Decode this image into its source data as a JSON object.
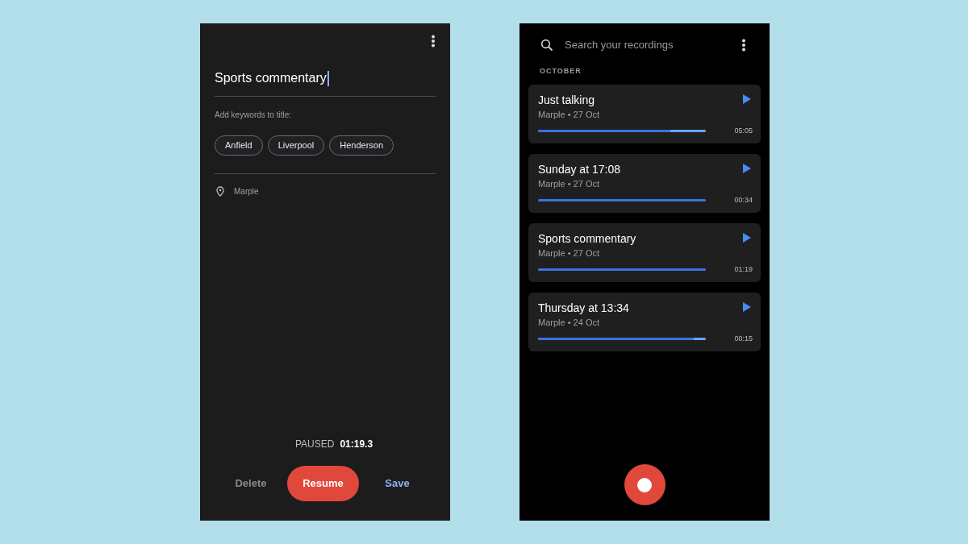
{
  "editor": {
    "title": "Sports commentary",
    "keywords_label": "Add keywords to title:",
    "keywords": [
      "Anfield",
      "Liverpool",
      "Henderson"
    ],
    "location": "Marple",
    "status": "PAUSED",
    "time": "01:19.3",
    "buttons": {
      "delete": "Delete",
      "resume": "Resume",
      "save": "Save"
    }
  },
  "library": {
    "search": {
      "placeholder": "Search your recordings"
    },
    "section": "OCTOBER",
    "recordings": [
      {
        "title": "Just talking",
        "meta": "Marple • 27 Oct",
        "duration": "05:05",
        "level": 0.79
      },
      {
        "title": "Sunday at 17:08",
        "meta": "Marple • 27 Oct",
        "duration": "00:34",
        "level": 1
      },
      {
        "title": "Sports commentary",
        "meta": "Marple • 27 Oct",
        "duration": "01:19",
        "level": 1
      },
      {
        "title": "Thursday at 13:34",
        "meta": "Marple • 24 Oct",
        "duration": "00:15",
        "level": 0.93
      }
    ]
  }
}
